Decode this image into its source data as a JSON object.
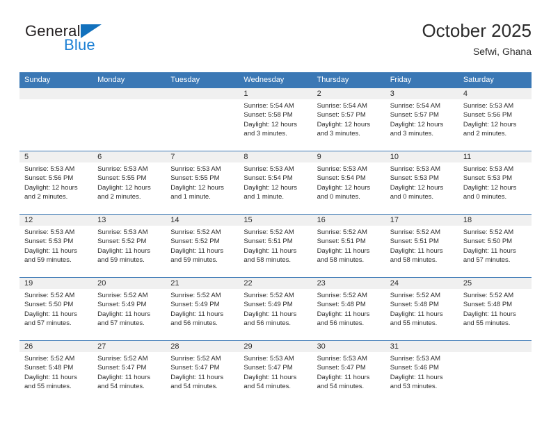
{
  "brand": {
    "name_part1": "General",
    "name_part2": "Blue",
    "triangle_color": "#1271bd",
    "blue_color": "#1b7fd4"
  },
  "header": {
    "title": "October 2025",
    "subtitle": "Sefwi, Ghana"
  },
  "theme": {
    "header_blue": "#3b78b5",
    "date_band_gray": "#f0f0f0",
    "text_color": "#2b2b2b"
  },
  "weekdays": [
    "Sunday",
    "Monday",
    "Tuesday",
    "Wednesday",
    "Thursday",
    "Friday",
    "Saturday"
  ],
  "weeks": [
    [
      {
        "day": "",
        "sunrise": "",
        "sunset": "",
        "daylight": ""
      },
      {
        "day": "",
        "sunrise": "",
        "sunset": "",
        "daylight": ""
      },
      {
        "day": "",
        "sunrise": "",
        "sunset": "",
        "daylight": ""
      },
      {
        "day": "1",
        "sunrise": "Sunrise: 5:54 AM",
        "sunset": "Sunset: 5:58 PM",
        "daylight": "Daylight: 12 hours and 3 minutes."
      },
      {
        "day": "2",
        "sunrise": "Sunrise: 5:54 AM",
        "sunset": "Sunset: 5:57 PM",
        "daylight": "Daylight: 12 hours and 3 minutes."
      },
      {
        "day": "3",
        "sunrise": "Sunrise: 5:54 AM",
        "sunset": "Sunset: 5:57 PM",
        "daylight": "Daylight: 12 hours and 3 minutes."
      },
      {
        "day": "4",
        "sunrise": "Sunrise: 5:53 AM",
        "sunset": "Sunset: 5:56 PM",
        "daylight": "Daylight: 12 hours and 2 minutes."
      }
    ],
    [
      {
        "day": "5",
        "sunrise": "Sunrise: 5:53 AM",
        "sunset": "Sunset: 5:56 PM",
        "daylight": "Daylight: 12 hours and 2 minutes."
      },
      {
        "day": "6",
        "sunrise": "Sunrise: 5:53 AM",
        "sunset": "Sunset: 5:55 PM",
        "daylight": "Daylight: 12 hours and 2 minutes."
      },
      {
        "day": "7",
        "sunrise": "Sunrise: 5:53 AM",
        "sunset": "Sunset: 5:55 PM",
        "daylight": "Daylight: 12 hours and 1 minute."
      },
      {
        "day": "8",
        "sunrise": "Sunrise: 5:53 AM",
        "sunset": "Sunset: 5:54 PM",
        "daylight": "Daylight: 12 hours and 1 minute."
      },
      {
        "day": "9",
        "sunrise": "Sunrise: 5:53 AM",
        "sunset": "Sunset: 5:54 PM",
        "daylight": "Daylight: 12 hours and 0 minutes."
      },
      {
        "day": "10",
        "sunrise": "Sunrise: 5:53 AM",
        "sunset": "Sunset: 5:53 PM",
        "daylight": "Daylight: 12 hours and 0 minutes."
      },
      {
        "day": "11",
        "sunrise": "Sunrise: 5:53 AM",
        "sunset": "Sunset: 5:53 PM",
        "daylight": "Daylight: 12 hours and 0 minutes."
      }
    ],
    [
      {
        "day": "12",
        "sunrise": "Sunrise: 5:53 AM",
        "sunset": "Sunset: 5:53 PM",
        "daylight": "Daylight: 11 hours and 59 minutes."
      },
      {
        "day": "13",
        "sunrise": "Sunrise: 5:53 AM",
        "sunset": "Sunset: 5:52 PM",
        "daylight": "Daylight: 11 hours and 59 minutes."
      },
      {
        "day": "14",
        "sunrise": "Sunrise: 5:52 AM",
        "sunset": "Sunset: 5:52 PM",
        "daylight": "Daylight: 11 hours and 59 minutes."
      },
      {
        "day": "15",
        "sunrise": "Sunrise: 5:52 AM",
        "sunset": "Sunset: 5:51 PM",
        "daylight": "Daylight: 11 hours and 58 minutes."
      },
      {
        "day": "16",
        "sunrise": "Sunrise: 5:52 AM",
        "sunset": "Sunset: 5:51 PM",
        "daylight": "Daylight: 11 hours and 58 minutes."
      },
      {
        "day": "17",
        "sunrise": "Sunrise: 5:52 AM",
        "sunset": "Sunset: 5:51 PM",
        "daylight": "Daylight: 11 hours and 58 minutes."
      },
      {
        "day": "18",
        "sunrise": "Sunrise: 5:52 AM",
        "sunset": "Sunset: 5:50 PM",
        "daylight": "Daylight: 11 hours and 57 minutes."
      }
    ],
    [
      {
        "day": "19",
        "sunrise": "Sunrise: 5:52 AM",
        "sunset": "Sunset: 5:50 PM",
        "daylight": "Daylight: 11 hours and 57 minutes."
      },
      {
        "day": "20",
        "sunrise": "Sunrise: 5:52 AM",
        "sunset": "Sunset: 5:49 PM",
        "daylight": "Daylight: 11 hours and 57 minutes."
      },
      {
        "day": "21",
        "sunrise": "Sunrise: 5:52 AM",
        "sunset": "Sunset: 5:49 PM",
        "daylight": "Daylight: 11 hours and 56 minutes."
      },
      {
        "day": "22",
        "sunrise": "Sunrise: 5:52 AM",
        "sunset": "Sunset: 5:49 PM",
        "daylight": "Daylight: 11 hours and 56 minutes."
      },
      {
        "day": "23",
        "sunrise": "Sunrise: 5:52 AM",
        "sunset": "Sunset: 5:48 PM",
        "daylight": "Daylight: 11 hours and 56 minutes."
      },
      {
        "day": "24",
        "sunrise": "Sunrise: 5:52 AM",
        "sunset": "Sunset: 5:48 PM",
        "daylight": "Daylight: 11 hours and 55 minutes."
      },
      {
        "day": "25",
        "sunrise": "Sunrise: 5:52 AM",
        "sunset": "Sunset: 5:48 PM",
        "daylight": "Daylight: 11 hours and 55 minutes."
      }
    ],
    [
      {
        "day": "26",
        "sunrise": "Sunrise: 5:52 AM",
        "sunset": "Sunset: 5:48 PM",
        "daylight": "Daylight: 11 hours and 55 minutes."
      },
      {
        "day": "27",
        "sunrise": "Sunrise: 5:52 AM",
        "sunset": "Sunset: 5:47 PM",
        "daylight": "Daylight: 11 hours and 54 minutes."
      },
      {
        "day": "28",
        "sunrise": "Sunrise: 5:52 AM",
        "sunset": "Sunset: 5:47 PM",
        "daylight": "Daylight: 11 hours and 54 minutes."
      },
      {
        "day": "29",
        "sunrise": "Sunrise: 5:53 AM",
        "sunset": "Sunset: 5:47 PM",
        "daylight": "Daylight: 11 hours and 54 minutes."
      },
      {
        "day": "30",
        "sunrise": "Sunrise: 5:53 AM",
        "sunset": "Sunset: 5:47 PM",
        "daylight": "Daylight: 11 hours and 54 minutes."
      },
      {
        "day": "31",
        "sunrise": "Sunrise: 5:53 AM",
        "sunset": "Sunset: 5:46 PM",
        "daylight": "Daylight: 11 hours and 53 minutes."
      },
      {
        "day": "",
        "sunrise": "",
        "sunset": "",
        "daylight": ""
      }
    ]
  ]
}
